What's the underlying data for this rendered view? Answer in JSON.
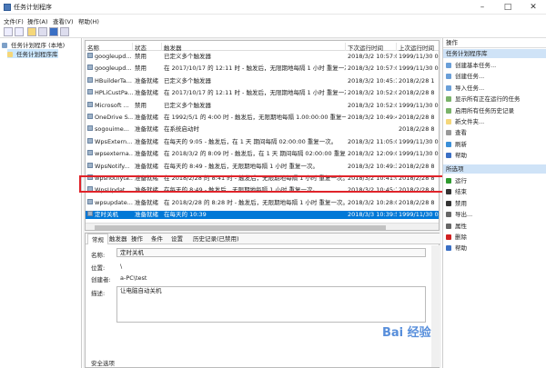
{
  "window": {
    "title": "任务计划程序"
  },
  "menu": [
    "文件(F)",
    "操作(A)",
    "查看(V)",
    "帮助(H)"
  ],
  "tree": {
    "root": "任务计划程序 (本地)",
    "child": "任务计划程序库"
  },
  "columns": [
    "名称",
    "状态",
    "触发器",
    "下次运行时间",
    "上次运行时间"
  ],
  "rows": [
    {
      "name": "googleupd...",
      "status": "禁用",
      "trigger": "已定义多个触发器",
      "next": "2018/3/2 10:57:03",
      "last": "1999/11/30 0"
    },
    {
      "name": "googleupd...",
      "status": "禁用",
      "trigger": "在 2017/10/17 的 12:11 时 - 触发后，无限期地每隔 1 小时 重复一次。",
      "next": "2018/3/2 10:57:03",
      "last": "1999/11/30 0"
    },
    {
      "name": "HBuilderTa...",
      "status": "准备就绪",
      "trigger": "已定义多个触发器",
      "next": "2018/3/2 10:45:11",
      "last": "2018/2/28 1"
    },
    {
      "name": "HPLiCustPa...",
      "status": "准备就绪",
      "trigger": "在 2017/10/17 的 12:11 时 - 触发后，无限期地每隔 1 小时 重复一次。",
      "next": "2018/3/2 10:52:03",
      "last": "2018/2/28 8"
    },
    {
      "name": "Microsoft ...",
      "status": "禁用",
      "trigger": "已定义多个触发器",
      "next": "2018/3/2 10:52:03",
      "last": "1999/11/30 0"
    },
    {
      "name": "OneDrive S...",
      "status": "准备就绪",
      "trigger": "在 1992/5/1 的 4:00 时 - 触发后，无限期地每隔 1.00:00:00 重复一次。",
      "next": "2018/3/2 10:49:47",
      "last": "2018/2/28 8"
    },
    {
      "name": "sogouime...",
      "status": "准备就绪",
      "trigger": "在系统启动时",
      "next": "",
      "last": "2018/2/28 8"
    },
    {
      "name": "WpsExtern...",
      "status": "准备就绪",
      "trigger": "在每天的 9:05 - 触发后，在 1 天 期间每隔 02:00:00 重复一次。",
      "next": "2018/3/2 11:05:00",
      "last": "1999/11/30 0"
    },
    {
      "name": "wpsexterna...",
      "status": "准备就绪",
      "trigger": "在 2018/3/2 的 8:09 时 - 触发后，在 1 天 期间每隔 02:00:00 重复一次。",
      "next": "2018/3/2 12:09:00",
      "last": "1999/11/30 0"
    },
    {
      "name": "WpsNotify...",
      "status": "准备就绪",
      "trigger": "在每天的 8:49 - 触发后，无限期地每隔 1 小时 重复一次。",
      "next": "2018/3/2 10:49:37",
      "last": "2018/2/28 8"
    },
    {
      "name": "wpsnotifyta...",
      "status": "准备就绪",
      "trigger": "在 2018/2/28 的 8:41 时 - 触发后，无限期地每隔 1 小时 重复一次。",
      "next": "2018/3/2 10:41:00",
      "last": "2018/2/28 8"
    },
    {
      "name": "WpsUpdat...",
      "status": "准备就绪",
      "trigger": "在每天的 8:49 - 触发后，无限期地每隔 1 小时 重复一次。",
      "next": "2018/3/2 10:45:15",
      "last": "2018/2/28 8"
    },
    {
      "name": "wpsupdate...",
      "status": "准备就绪",
      "trigger": "在 2018/2/28 的 8:28 时 - 触发后，无限期地每隔 1 小时 重复一次。",
      "next": "2018/3/2 10:28:00",
      "last": "2018/2/28 8"
    },
    {
      "name": "定时关机",
      "status": "准备就绪",
      "trigger": "在每天的 10:39",
      "next": "2018/3/3 10:39:57",
      "last": "1999/11/30 0"
    }
  ],
  "detailTabs": [
    "常规",
    "触发器",
    "操作",
    "条件",
    "设置",
    "历史记录(已禁用)"
  ],
  "details": {
    "nameLabel": "名称:",
    "nameValue": "定时关机",
    "locLabel": "位置:",
    "locValue": "\\",
    "authorLabel": "创建者:",
    "authorValue": "a-PC\\test",
    "descLabel": "描述:",
    "descValue": "让电脑自动关机",
    "security": "安全选项"
  },
  "actions": {
    "header": "操作",
    "section1": "任务计划程序库",
    "items1": [
      "创建基本任务...",
      "创建任务...",
      "导入任务...",
      "显示所有正在运行的任务",
      "启用所有任务历史记录",
      "新文件夹...",
      "查看",
      "刷新",
      "帮助"
    ],
    "section2": "所选项",
    "items2": [
      "运行",
      "结束",
      "禁用",
      "导出...",
      "属性",
      "删除",
      "帮助"
    ]
  },
  "watermark": "Bai 经验"
}
